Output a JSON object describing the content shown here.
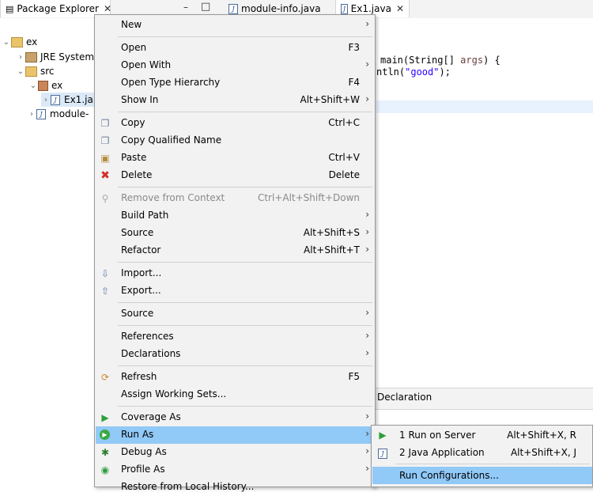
{
  "tabs": {
    "package_explorer": "Package Explorer",
    "module_info": "module-info.java",
    "ex1": "Ex1.java",
    "close": "✕",
    "minimize": "–",
    "maximize": "□"
  },
  "tree": {
    "project": "ex",
    "jre": "JRE System",
    "src": "src",
    "pkg": "ex",
    "file": "Ex1.ja",
    "module": "module-"
  },
  "editor": {
    "line1_pre": "main(String[] ",
    "line1_param": "args",
    "line1_post": ") {",
    "line2_pre": "ntln(",
    "line2_str": "\"good\"",
    "line2_post": ");"
  },
  "bottom_tab": "Declaration",
  "menu": {
    "new": {
      "label": "New",
      "arrow": "›"
    },
    "open": {
      "label": "Open",
      "shortcut": "F3"
    },
    "open_with": {
      "label": "Open With",
      "arrow": "›"
    },
    "open_type_hierarchy": {
      "label": "Open Type Hierarchy",
      "shortcut": "F4"
    },
    "show_in": {
      "label": "Show In",
      "shortcut": "Alt+Shift+W",
      "arrow": "›"
    },
    "copy": {
      "label": "Copy",
      "shortcut": "Ctrl+C"
    },
    "copy_qualified_name": {
      "label": "Copy Qualified Name"
    },
    "paste": {
      "label": "Paste",
      "shortcut": "Ctrl+V"
    },
    "delete": {
      "label": "Delete",
      "shortcut": "Delete"
    },
    "remove_from_context": {
      "label": "Remove from Context",
      "shortcut": "Ctrl+Alt+Shift+Down"
    },
    "build_path": {
      "label": "Build Path",
      "arrow": "›"
    },
    "source1": {
      "label": "Source",
      "shortcut": "Alt+Shift+S",
      "arrow": "›"
    },
    "refactor": {
      "label": "Refactor",
      "shortcut": "Alt+Shift+T",
      "arrow": "›"
    },
    "import": {
      "label": "Import..."
    },
    "export": {
      "label": "Export..."
    },
    "source2": {
      "label": "Source",
      "arrow": "›"
    },
    "references": {
      "label": "References",
      "arrow": "›"
    },
    "declarations": {
      "label": "Declarations",
      "arrow": "›"
    },
    "refresh": {
      "label": "Refresh",
      "shortcut": "F5"
    },
    "assign_working_sets": {
      "label": "Assign Working Sets..."
    },
    "coverage_as": {
      "label": "Coverage As",
      "arrow": "›"
    },
    "run_as": {
      "label": "Run As",
      "arrow": "›"
    },
    "debug_as": {
      "label": "Debug As",
      "arrow": "›"
    },
    "profile_as": {
      "label": "Profile As",
      "arrow": "›"
    },
    "restore_local_history": {
      "label": "Restore from Local History..."
    }
  },
  "submenu": {
    "run_on_server": {
      "label": "1 Run on Server",
      "shortcut": "Alt+Shift+X, R"
    },
    "java_application": {
      "label": "2 Java Application",
      "shortcut": "Alt+Shift+X, J"
    },
    "run_configurations": {
      "label": "Run Configurations..."
    }
  },
  "colors": {
    "selection": "#91c9f7",
    "menu_bg": "#f2f2f2",
    "current_line": "#e8f2fe",
    "string": "#2a00ff"
  }
}
